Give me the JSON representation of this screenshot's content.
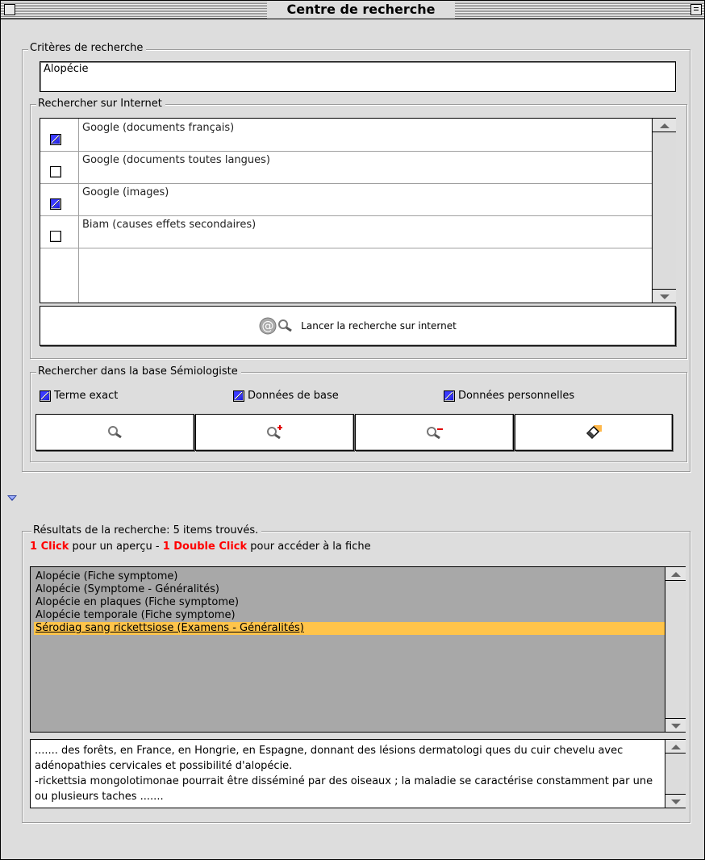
{
  "window": {
    "title": "Centre de recherche"
  },
  "criteria": {
    "group_label": "Critères de recherche",
    "query_value": "Alopécie"
  },
  "internet": {
    "group_label": "Rechercher sur Internet",
    "sources": [
      {
        "label": "Google (documents français)",
        "checked": true
      },
      {
        "label": "Google (documents toutes langues)",
        "checked": false
      },
      {
        "label": "Google (images)",
        "checked": true
      },
      {
        "label": "Biam (causes effets secondaires)",
        "checked": false
      }
    ],
    "launch_label": "Lancer la recherche sur internet",
    "launch_icons": [
      "at-sign-icon",
      "magnifier-icon"
    ]
  },
  "semiologiste": {
    "group_label": "Rechercher dans la base Sémiologiste",
    "options": [
      {
        "label": "Terme exact",
        "checked": true
      },
      {
        "label": "Données de base",
        "checked": true
      },
      {
        "label": "Données personnelles",
        "checked": true
      }
    ],
    "toolbar_icons": [
      "search-icon",
      "search-add-icon",
      "search-remove-icon",
      "eraser-icon"
    ]
  },
  "results": {
    "group_label": "Résultats de la recherche: 5 items trouvés.",
    "hint": {
      "click_label": "1 Click",
      "middle": " pour un aperçu - ",
      "double_click_label": "1 Double Click",
      "end": " pour accéder à la fiche"
    },
    "items": [
      "Alopécie (Fiche symptome)",
      "Alopécie (Symptome - Généralités)",
      "Alopécie en plaques (Fiche symptome)",
      "Alopécie temporale (Fiche symptome)",
      "Sérodiag sang rickettsiose (Examens - Généralités)"
    ],
    "selected_index": 4,
    "preview_text": "....... des forêts, en France, en Hongrie, en Espagne, donnant des lésions dermatologi ques du cuir chevelu avec adénopathies cervicales et possibilité d'alopécie.\n-rickettsia mongolotimonae pourrait être disséminé par des oiseaux ; la maladie se caractérise constamment par une ou plusieurs taches ......."
  },
  "colors": {
    "selection": "#ffc44a",
    "hint_red": "#ff0000",
    "checkbox_blue": "#3a3aff",
    "window_bg": "#dddddd"
  }
}
